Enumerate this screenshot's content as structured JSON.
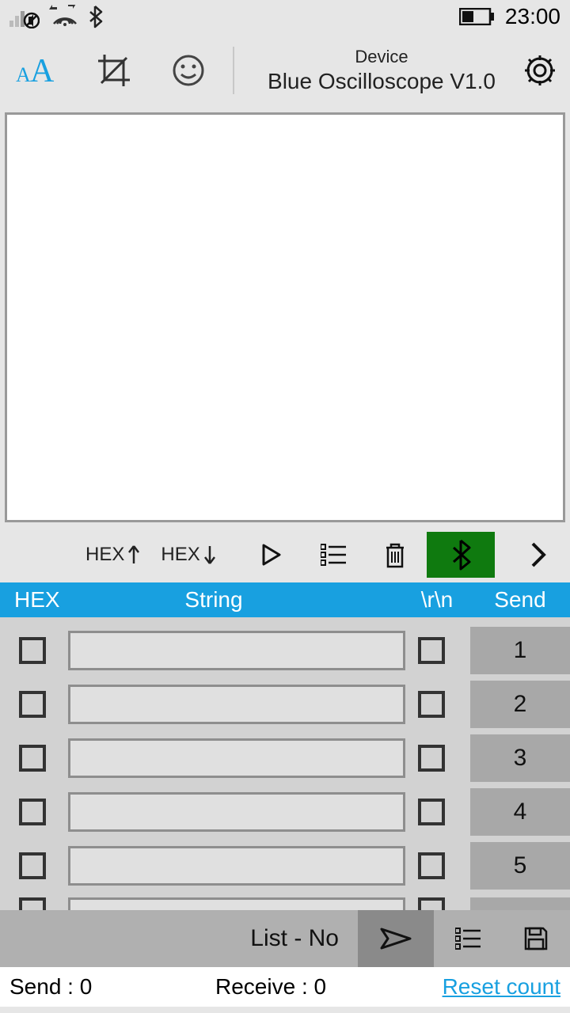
{
  "status": {
    "time": "23:00"
  },
  "header": {
    "device_label": "Device",
    "device_name": "Blue Oscilloscope V1.0"
  },
  "midbar": {
    "hex_up": "HEX",
    "hex_down": "HEX"
  },
  "columns": {
    "hex": "HEX",
    "string": "String",
    "crlf": "\\r\\n",
    "send": "Send"
  },
  "rows": [
    {
      "hex_checked": false,
      "value": "",
      "crlf_checked": false,
      "send_label": "1"
    },
    {
      "hex_checked": false,
      "value": "",
      "crlf_checked": false,
      "send_label": "2"
    },
    {
      "hex_checked": false,
      "value": "",
      "crlf_checked": false,
      "send_label": "3"
    },
    {
      "hex_checked": false,
      "value": "",
      "crlf_checked": false,
      "send_label": "4"
    },
    {
      "hex_checked": false,
      "value": "",
      "crlf_checked": false,
      "send_label": "5"
    }
  ],
  "actionbar": {
    "list_label": "List - No"
  },
  "footer": {
    "send_label": "Send :  0",
    "receive_label": "Receive :  0",
    "reset_label": "Reset count"
  }
}
